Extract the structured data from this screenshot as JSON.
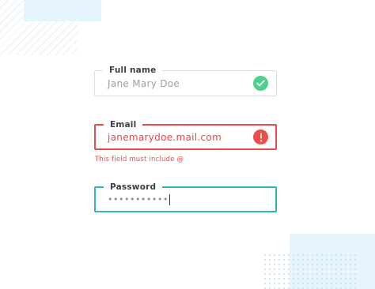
{
  "form": {
    "full_name": {
      "label": "Full name",
      "value": "Jane Mary Doe",
      "status": "valid",
      "status_icon": "check-circle-icon"
    },
    "email": {
      "label": "Email",
      "value": "janemarydoe.mail.com",
      "status": "error",
      "status_icon": "alert-circle-icon",
      "error_message": "This field must include @"
    },
    "password": {
      "label": "Password",
      "value": "•••••••••••",
      "status": "focused"
    }
  },
  "colors": {
    "valid": "#4cd08a",
    "error": "#ef4b4b",
    "focus": "#2fb3c8",
    "default_border": "#dadde1",
    "label": "#3a3f45"
  }
}
